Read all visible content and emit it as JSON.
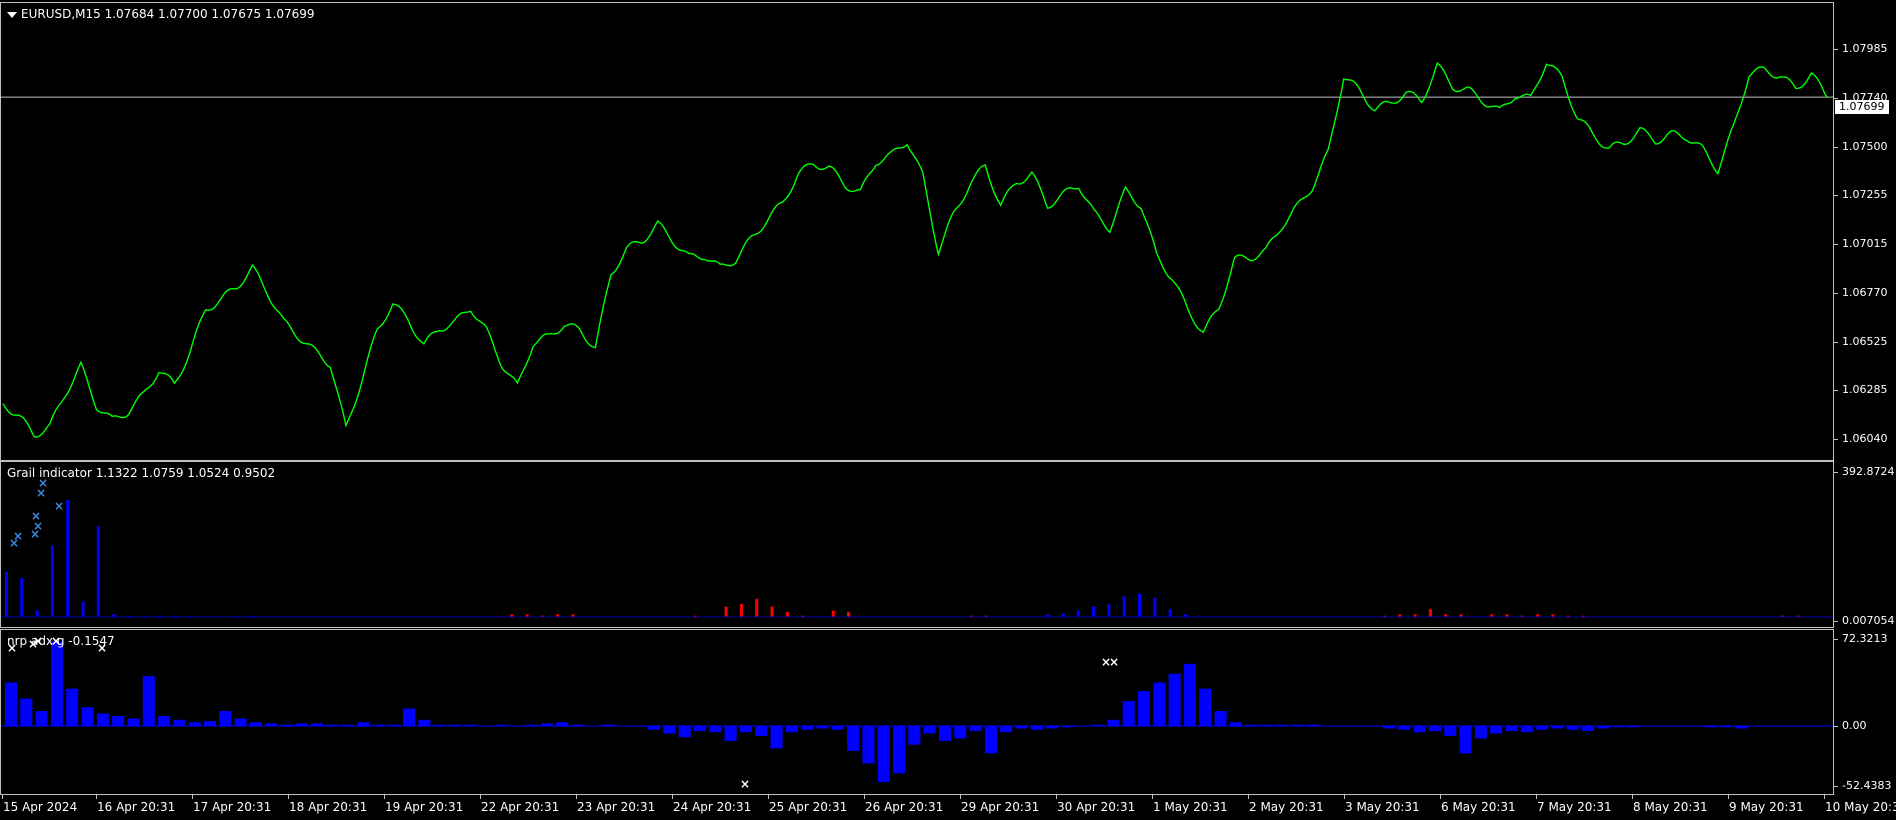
{
  "chart": {
    "symbol_header": "EURUSD,M15  1.07684 1.07700 1.07675 1.07699",
    "current_price": "1.07699",
    "price_ticks": [
      "1.07985",
      "1.07740",
      "1.07500",
      "1.07255",
      "1.07015",
      "1.06770",
      "1.06525",
      "1.06285",
      "1.06040"
    ],
    "colors": {
      "price_line": "#00ff00",
      "grail_pos": "#0000ff",
      "grail_neg": "#ff0000",
      "nrp": "#0000ff",
      "marker_blue": "#3a8ee6",
      "marker_white": "#ffffff",
      "hline": "#c0c0c0"
    }
  },
  "grail": {
    "title": "Grail indicator 1.1322 1.0759 1.0524 0.9502",
    "ticks": [
      "392.8724",
      "0.007054"
    ]
  },
  "nrp": {
    "title": "nrp adx g -0.1547",
    "ticks": [
      "72.3213",
      "0.00",
      "-52.4383"
    ]
  },
  "time_axis": [
    "15 Apr 2024",
    "16 Apr 20:31",
    "17 Apr 20:31",
    "18 Apr 20:31",
    "19 Apr 20:31",
    "22 Apr 20:31",
    "23 Apr 20:31",
    "24 Apr 20:31",
    "25 Apr 20:31",
    "26 Apr 20:31",
    "29 Apr 20:31",
    "30 Apr 20:31",
    "1 May 20:31",
    "2 May 20:31",
    "3 May 20:31",
    "6 May 20:31",
    "7 May 20:31",
    "8 May 20:31",
    "9 May 20:31",
    "10 May 20:3"
  ],
  "chart_data": {
    "type": "line",
    "title": "EURUSD,M15",
    "ylim": [
      1.0595,
      1.0815
    ],
    "series": [
      {
        "name": "EURUSD",
        "values": [
          1.0623,
          1.0617,
          1.0608,
          1.0612,
          1.0628,
          1.0641,
          1.0622,
          1.0615,
          1.0619,
          1.0627,
          1.0639,
          1.0632,
          1.0648,
          1.0668,
          1.0673,
          1.0679,
          1.0688,
          1.0676,
          1.0662,
          1.0655,
          1.0648,
          1.0642,
          1.0611,
          1.0634,
          1.0658,
          1.0671,
          1.0663,
          1.0651,
          1.0659,
          1.0662,
          1.0669,
          1.0658,
          1.0642,
          1.0631,
          1.0652,
          1.0655,
          1.0661,
          1.0658,
          1.065,
          1.0685,
          1.0697,
          1.0701,
          1.0709,
          1.0701,
          1.0693,
          1.0694,
          1.0688,
          1.0692,
          1.0702,
          1.0711,
          1.0719,
          1.0733,
          1.0738,
          1.0736,
          1.0728,
          1.0724,
          1.0739,
          1.0742,
          1.0749,
          1.0732,
          1.0696,
          1.0714,
          1.0728,
          1.0737,
          1.0718,
          1.0729,
          1.0733,
          1.0718,
          1.0723,
          1.0728,
          1.0714,
          1.0707,
          1.0725,
          1.0718,
          1.0694,
          1.0683,
          1.0668,
          1.0657,
          1.0669,
          1.0692,
          1.0693,
          1.0696,
          1.0708,
          1.0717,
          1.0727,
          1.0743,
          1.078,
          1.0773,
          1.0764,
          1.0767,
          1.0772,
          1.0768,
          1.0785,
          1.0775,
          1.0773,
          1.0768,
          1.0763,
          1.0771,
          1.0769,
          1.0787,
          1.0779,
          1.076,
          1.0752,
          1.0745,
          1.0748,
          1.0754,
          1.0749,
          1.0752,
          1.0751,
          1.0745,
          1.0735,
          1.0755,
          1.0781,
          1.0783,
          1.078,
          1.0774,
          1.0781,
          1.077
        ]
      }
    ]
  },
  "indicators": {
    "grail_values": [
      0.35,
      0.3,
      0.05,
      0.55,
      0.9,
      0.12,
      0.7,
      0.02,
      0.01,
      0.01,
      0.01,
      0.01,
      0.01,
      0,
      0,
      0.01,
      0.01,
      0,
      0,
      0,
      0,
      0,
      0,
      0,
      0,
      0,
      0,
      0,
      0,
      0,
      0,
      0,
      0,
      -0.02,
      -0.02,
      -0.01,
      -0.02,
      -0.02,
      0,
      0,
      0,
      0,
      0,
      0,
      0,
      -0.01,
      0,
      -0.08,
      -0.1,
      -0.14,
      -0.08,
      -0.04,
      -0.01,
      0,
      -0.05,
      -0.04,
      0,
      0,
      0,
      0,
      0,
      0,
      0,
      -0.01,
      -0.01,
      0,
      0,
      0,
      0.02,
      0.03,
      0.05,
      0.08,
      0.1,
      0.16,
      0.18,
      0.15,
      0.06,
      0.02,
      0,
      0,
      0,
      0,
      0,
      0,
      0,
      0,
      0,
      0,
      0,
      0,
      -0.01,
      -0.02,
      -0.02,
      -0.06,
      -0.02,
      -0.02,
      0,
      -0.02,
      -0.02,
      -0.01,
      -0.02,
      -0.02,
      -0.01,
      -0.01,
      0,
      0,
      0,
      0,
      0,
      0,
      0,
      0,
      0,
      0,
      0,
      0,
      -0.01,
      -0.01,
      0,
      0
    ],
    "nrp_values": [
      35,
      22,
      12,
      68,
      30,
      15,
      10,
      8,
      6,
      40,
      8,
      5,
      3,
      4,
      12,
      6,
      3,
      2,
      1,
      2,
      2,
      1,
      1,
      3,
      1,
      1,
      14,
      5,
      1,
      1,
      1,
      0,
      1,
      0,
      1,
      2,
      3,
      1,
      0,
      1,
      0,
      0,
      -3,
      -6,
      -9,
      -4,
      -5,
      -12,
      -5,
      -8,
      -18,
      -5,
      -3,
      -2,
      -3,
      -20,
      -30,
      -45,
      -38,
      -15,
      -6,
      -12,
      -10,
      -4,
      -22,
      -5,
      -2,
      -3,
      -2,
      -1,
      0,
      1,
      5,
      20,
      28,
      35,
      42,
      50,
      30,
      12,
      3,
      1,
      1,
      1,
      1,
      1,
      0,
      0,
      0,
      0,
      -2,
      -3,
      -5,
      -4,
      -8,
      -22,
      -10,
      -6,
      -4,
      -5,
      -3,
      -2,
      -3,
      -4,
      -2,
      -1,
      -1,
      0,
      0,
      0,
      0,
      -1,
      -1,
      -2,
      0,
      0,
      0,
      0,
      0,
      0
    ]
  }
}
